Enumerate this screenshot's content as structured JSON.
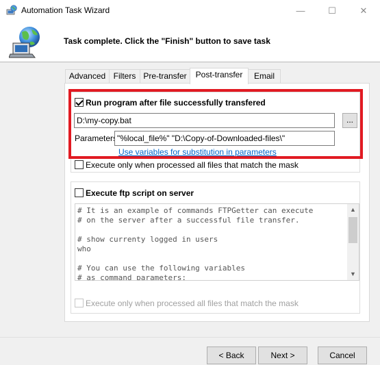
{
  "window": {
    "title": "Automation Task Wizard",
    "minimize_glyph": "—",
    "maximize_glyph": "☐",
    "close_glyph": "✕"
  },
  "header": {
    "text": "Task complete. Click the \"Finish\" button to save task"
  },
  "tabs": [
    {
      "label": "Advanced"
    },
    {
      "label": "Filters"
    },
    {
      "label": "Pre-transfer"
    },
    {
      "label": "Post-transfer",
      "active": true
    },
    {
      "label": "Email"
    }
  ],
  "run_program": {
    "checkbox_label": "Run program after file successfully transfered",
    "checked": true,
    "program_path": "D:\\my-copy.bat",
    "browse_label": "...",
    "parameters_label": "Parameters",
    "parameters_value": "\"%local_file%\" \"D:\\Copy-of-Downloaded-files\\\"",
    "variables_link": "Use variables for substitution in parameters",
    "execute_only_label": "Execute only when processed all files that match the mask",
    "execute_only_checked": false
  },
  "ftp_script": {
    "checkbox_label": "Execute ftp script on server",
    "checked": false,
    "script_text": "# It is an example of commands FTPGetter can execute\n# on the server after a successful file transfer.\n\n# show currenty logged in users\nwho\n\n# You can use the following variables\n# as command parameters:",
    "execute_only_label": "Execute only when processed all files that match the mask",
    "execute_only_checked": false
  },
  "footer": {
    "back_label": "< Back",
    "next_label": "Next >",
    "cancel_label": "Cancel"
  },
  "colors": {
    "highlight_border": "#e11a22",
    "link": "#0066cc"
  },
  "icons": {
    "app": "globe-computer-icon",
    "header": "globe-laptop-icon"
  }
}
